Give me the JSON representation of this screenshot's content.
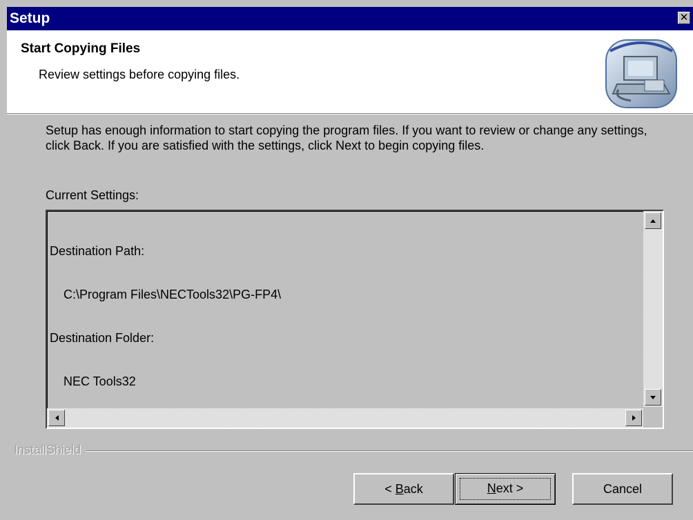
{
  "window": {
    "title": "Setup",
    "close_glyph": "✕"
  },
  "header": {
    "title": "Start Copying Files",
    "subtitle": "Review settings before copying files.",
    "icon": "computer-setup-icon"
  },
  "body": {
    "intro": "Setup has enough information to start copying the program files.  If you want to review or change any settings, click Back.  If you are satisfied with the settings, click Next to begin copying files.",
    "settings_label": "Current Settings:",
    "settings": [
      {
        "label": "Destination Path:",
        "value": "C:\\Program Files\\NECTools32\\PG-FP4\\"
      },
      {
        "label": "Destination Folder:",
        "value": "NEC Tools32"
      }
    ]
  },
  "footer": {
    "brand": "InstallShield",
    "back_pre": "< ",
    "back_key": "B",
    "back_post": "ack",
    "next_key": "N",
    "next_post": "ext >",
    "cancel_label": "Cancel"
  },
  "colors": {
    "titlebar": "#000080",
    "face": "#c0c0c0",
    "header_bg": "#ffffff"
  }
}
